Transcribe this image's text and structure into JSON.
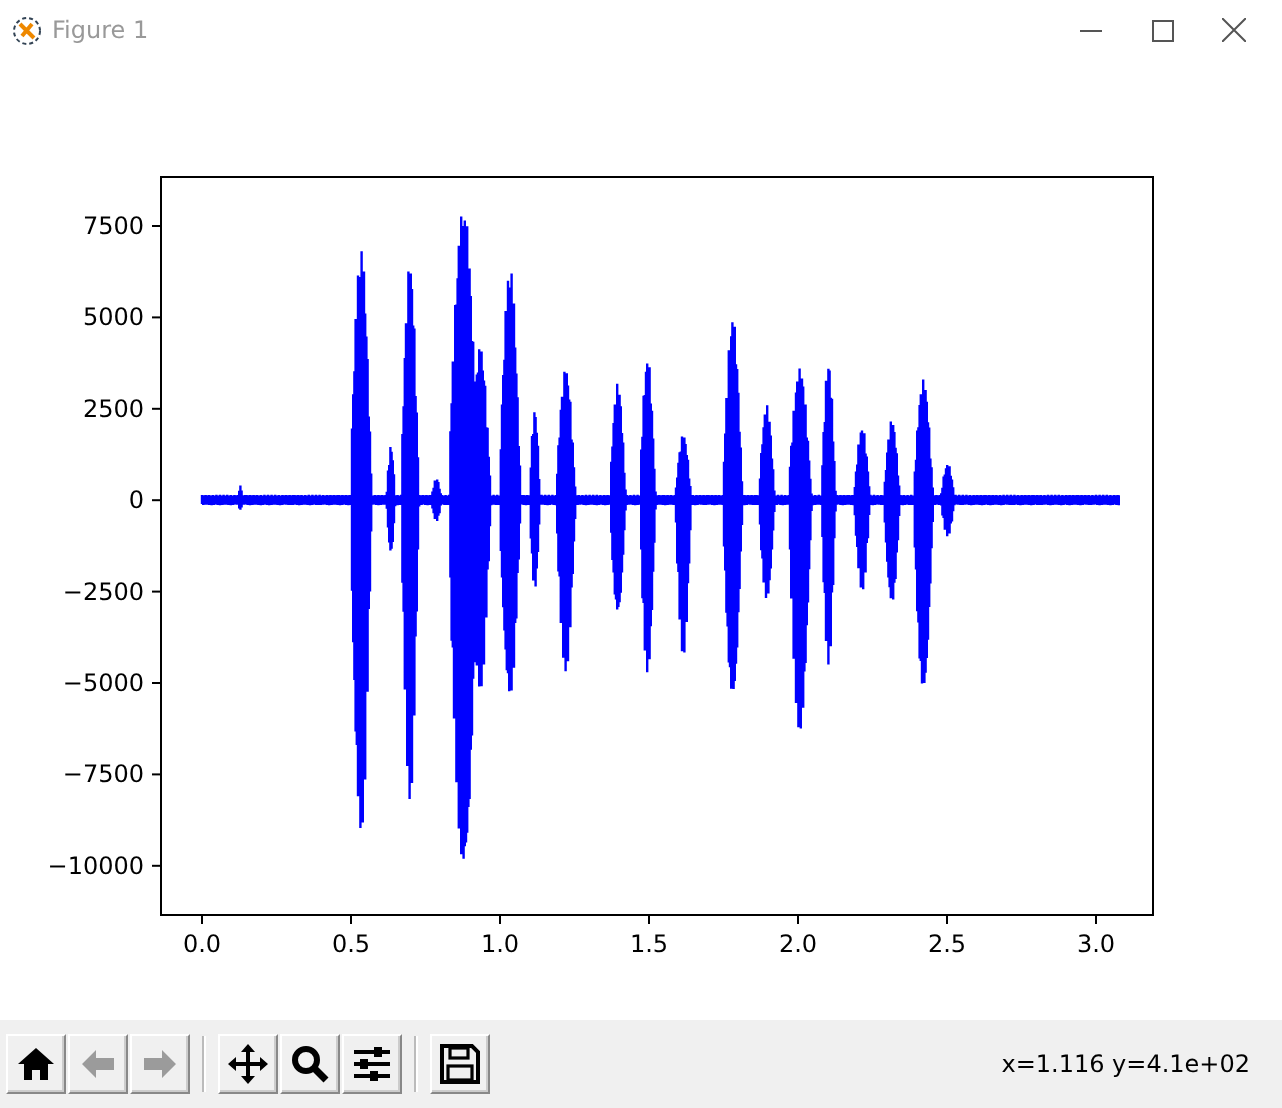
{
  "window": {
    "title": "Figure 1"
  },
  "plot": {
    "yticks": [
      "7500",
      "5000",
      "2500",
      "0",
      "−2500",
      "−5000",
      "−7500",
      "−10000"
    ],
    "xticks": [
      "0.0",
      "0.5",
      "1.0",
      "1.5",
      "2.0",
      "2.5",
      "3.0"
    ]
  },
  "toolbar": {
    "groups": [
      [
        {
          "kind": "home",
          "disabled": false
        },
        {
          "kind": "back",
          "disabled": true
        },
        {
          "kind": "forward",
          "disabled": true
        }
      ],
      [
        {
          "kind": "pan",
          "disabled": false
        },
        {
          "kind": "zoom",
          "disabled": false
        },
        {
          "kind": "subplots",
          "disabled": false
        }
      ],
      [
        {
          "kind": "save",
          "disabled": false
        }
      ]
    ]
  },
  "status": "x=1.116 y=4.1e+02"
}
